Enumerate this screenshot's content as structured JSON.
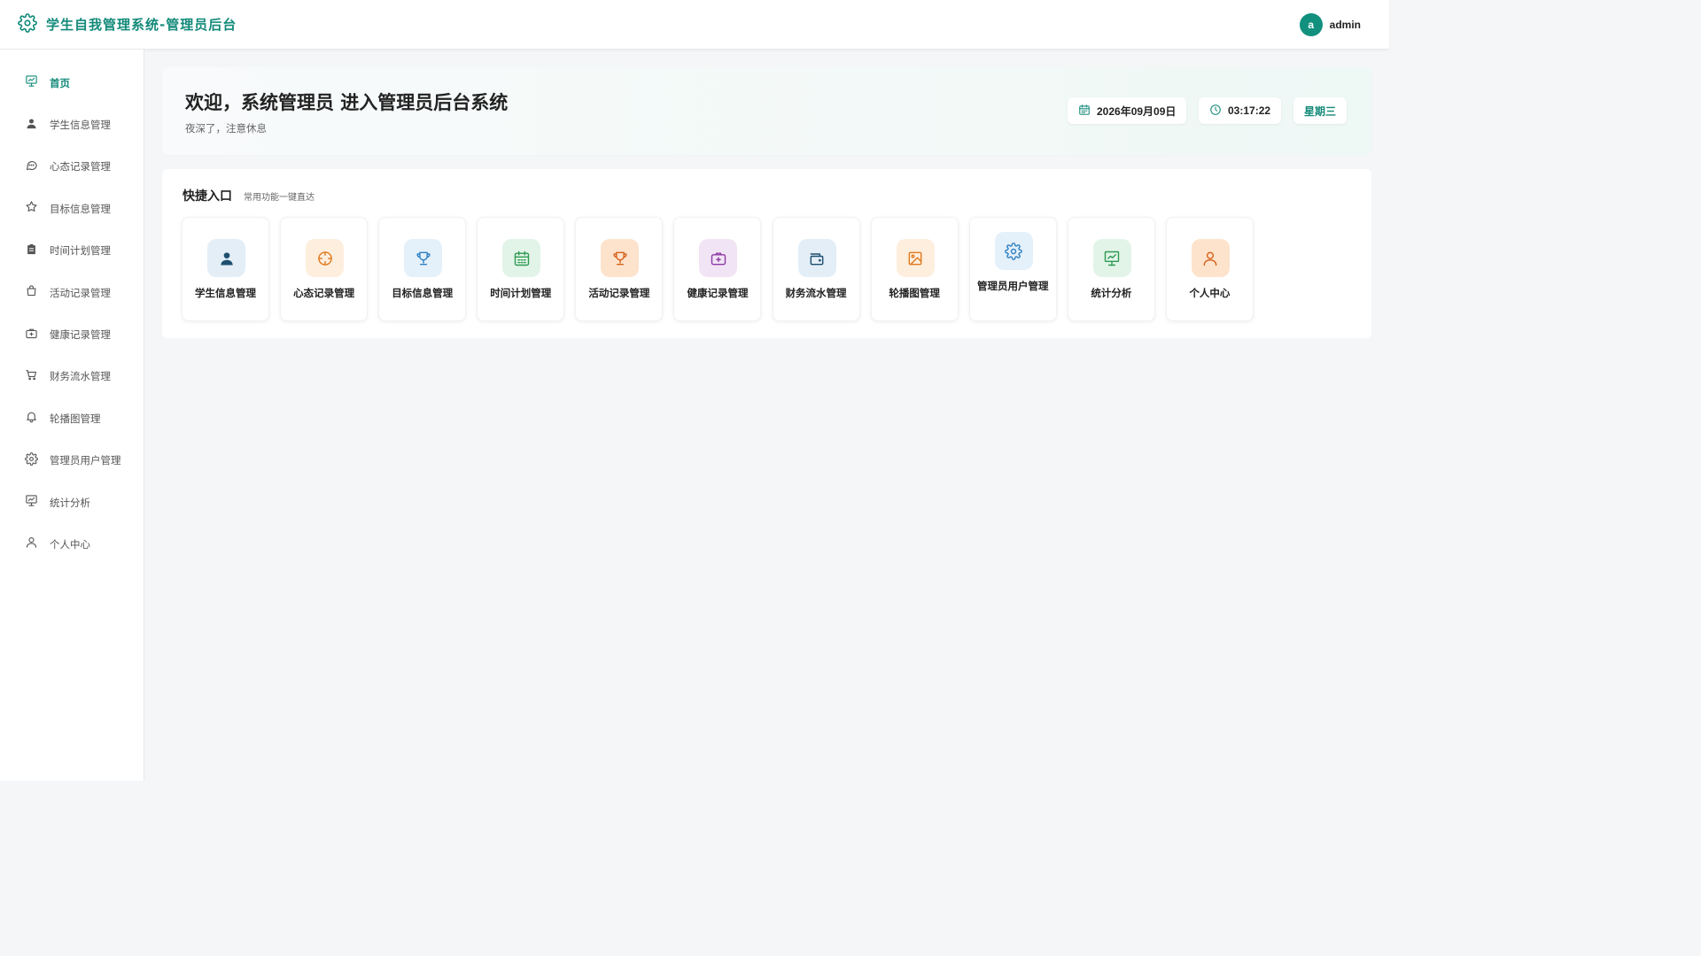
{
  "app": {
    "title": "学生自我管理系统-管理员后台",
    "logo_icon": "gear-icon",
    "accent_color": "#138a7a"
  },
  "user": {
    "avatar_letter": "a",
    "name": "admin"
  },
  "sidebar": {
    "items": [
      {
        "label": "首页",
        "icon": "presentation-chart-icon",
        "active": true
      },
      {
        "label": "学生信息管理",
        "icon": "user-icon",
        "active": false
      },
      {
        "label": "心态记录管理",
        "icon": "chat-bubble-icon",
        "active": false
      },
      {
        "label": "目标信息管理",
        "icon": "star-icon",
        "active": false
      },
      {
        "label": "时间计划管理",
        "icon": "clipboard-icon",
        "active": false
      },
      {
        "label": "活动记录管理",
        "icon": "shopping-bag-icon",
        "active": false
      },
      {
        "label": "健康记录管理",
        "icon": "first-aid-kit-icon",
        "active": false
      },
      {
        "label": "财务流水管理",
        "icon": "shopping-cart-icon",
        "active": false
      },
      {
        "label": "轮播图管理",
        "icon": "bell-icon",
        "active": false
      },
      {
        "label": "管理员用户管理",
        "icon": "gear-icon",
        "active": false
      },
      {
        "label": "统计分析",
        "icon": "presentation-chart-icon",
        "active": false
      },
      {
        "label": "个人中心",
        "icon": "user-outline-icon",
        "active": false
      }
    ]
  },
  "welcome": {
    "title": "欢迎，系统管理员 进入管理员后台系统",
    "subtitle": "夜深了，注意休息",
    "date": "2026年09月09日",
    "time": "03:17:22",
    "weekday": "星期三"
  },
  "quick": {
    "title": "快捷入口",
    "subtitle": "常用功能一键直达",
    "cards": [
      {
        "label": "学生信息管理",
        "icon": "user-icon",
        "color": "#1e4f70",
        "bg": "#e3eef7"
      },
      {
        "label": "心态记录管理",
        "icon": "compass-icon",
        "color": "#e07b1f",
        "bg": "#fdeedd"
      },
      {
        "label": "目标信息管理",
        "icon": "trophy-icon",
        "color": "#2f7fc1",
        "bg": "#e4f0fa"
      },
      {
        "label": "时间计划管理",
        "icon": "calendar-icon",
        "color": "#2e9a52",
        "bg": "#e2f4e8"
      },
      {
        "label": "活动记录管理",
        "icon": "trophy-icon",
        "color": "#d5601a",
        "bg": "#fde3cc"
      },
      {
        "label": "健康记录管理",
        "icon": "first-aid-kit-icon",
        "color": "#8e3ba6",
        "bg": "#f1e4f5"
      },
      {
        "label": "财务流水管理",
        "icon": "wallet-icon",
        "color": "#1e4f70",
        "bg": "#e3eef7"
      },
      {
        "label": "轮播图管理",
        "icon": "image-icon",
        "color": "#e07b1f",
        "bg": "#fdeedd"
      },
      {
        "label": "管理员用户管理",
        "icon": "gear-icon",
        "color": "#2f7fc1",
        "bg": "#e4f0fa"
      },
      {
        "label": "统计分析",
        "icon": "presentation-chart-icon",
        "color": "#2e9a52",
        "bg": "#e2f4e8"
      },
      {
        "label": "个人中心",
        "icon": "user-outline-icon",
        "color": "#d5601a",
        "bg": "#fde3cc"
      }
    ]
  }
}
